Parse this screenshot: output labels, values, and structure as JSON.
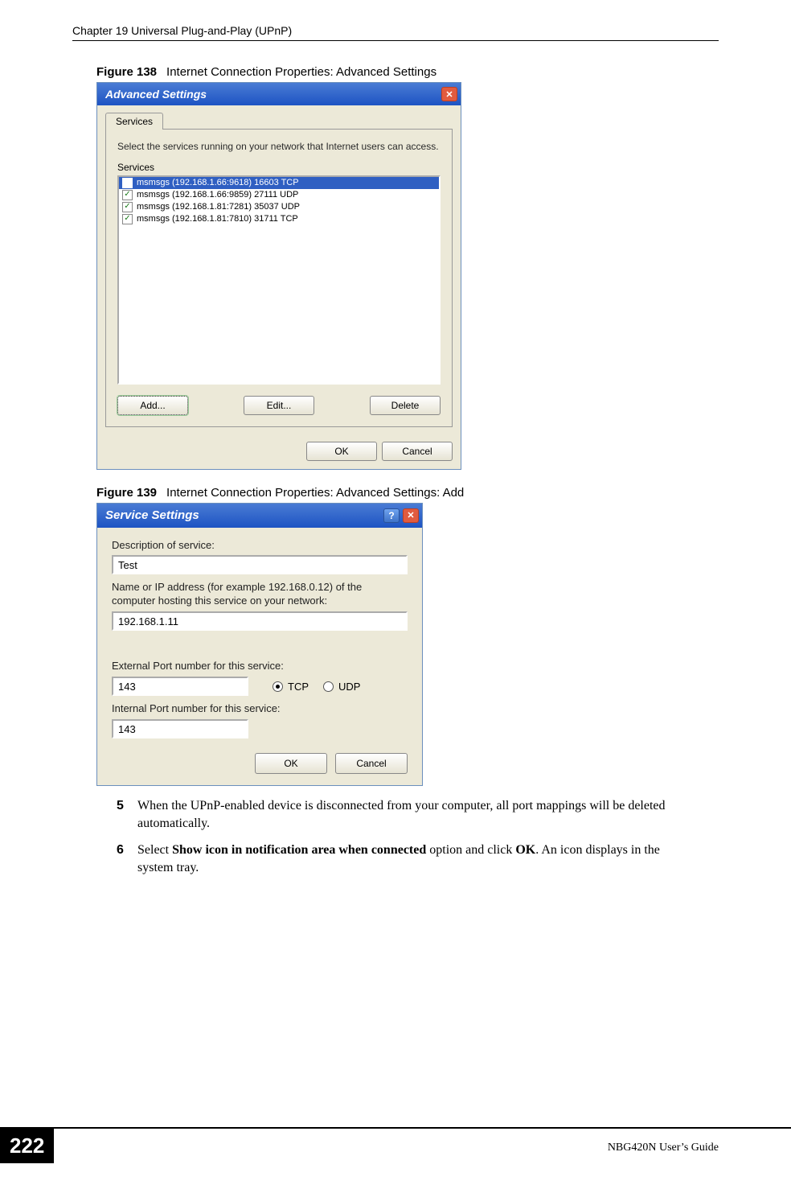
{
  "header": {
    "chapter": "Chapter 19 Universal Plug-and-Play (UPnP)"
  },
  "figure138": {
    "caption_num": "Figure 138",
    "caption_text": "Internet Connection Properties: Advanced Settings",
    "title": "Advanced Settings",
    "tab": "Services",
    "instruction": "Select the services running on your network that Internet users can access.",
    "group_label": "Services",
    "services": [
      "msmsgs (192.168.1.66:9618) 16603 TCP",
      "msmsgs (192.168.1.66:9859) 27111 UDP",
      "msmsgs (192.168.1.81:7281) 35037 UDP",
      "msmsgs (192.168.1.81:7810) 31711 TCP"
    ],
    "buttons": {
      "add": "Add...",
      "edit": "Edit...",
      "delete": "Delete"
    },
    "ok": "OK",
    "cancel": "Cancel"
  },
  "figure139": {
    "caption_num": "Figure 139",
    "caption_text": "Internet Connection Properties: Advanced Settings: Add",
    "title": "Service Settings",
    "labels": {
      "desc": "Description of service:",
      "host": "Name or IP address (for example 192.168.0.12) of the computer hosting this service on your network:",
      "ext": "External Port number for this service:",
      "int": "Internal Port number for this service:"
    },
    "values": {
      "desc": "Test",
      "host": "192.168.1.11",
      "ext": "143",
      "int": "143"
    },
    "radios": {
      "tcp": "TCP",
      "udp": "UDP",
      "selected": "tcp"
    },
    "ok": "OK",
    "cancel": "Cancel"
  },
  "steps": {
    "s5": "When the UPnP-enabled device is disconnected from your computer, all port mappings will be deleted automatically.",
    "s6_pre": "Select ",
    "s6_bold1": "Show icon in notification area when connected",
    "s6_mid": " option and click ",
    "s6_bold2": "OK",
    "s6_post": ". An icon displays in the system tray."
  },
  "footer": {
    "page": "222",
    "guide": "NBG420N User’s Guide"
  }
}
